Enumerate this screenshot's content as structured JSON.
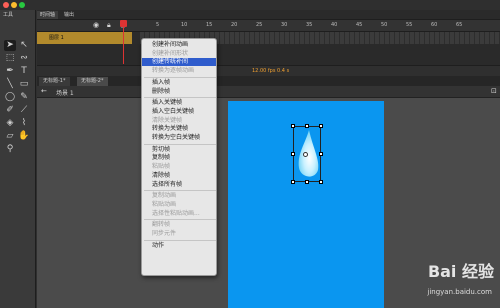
{
  "toolbox": {
    "title": "工具",
    "tools": [
      {
        "name": "selection-tool-icon",
        "glyph": "➤",
        "selected": true
      },
      {
        "name": "subselection-tool-icon",
        "glyph": "↖"
      },
      {
        "name": "free-transform-tool-icon",
        "glyph": "⬚"
      },
      {
        "name": "lasso-tool-icon",
        "glyph": "∾"
      },
      {
        "name": "pen-tool-icon",
        "glyph": "✒"
      },
      {
        "name": "text-tool-icon",
        "glyph": "T"
      },
      {
        "name": "line-tool-icon",
        "glyph": "╲"
      },
      {
        "name": "rectangle-tool-icon",
        "glyph": "▭"
      },
      {
        "name": "oval-tool-icon",
        "glyph": "◯"
      },
      {
        "name": "pencil-tool-icon",
        "glyph": "✎"
      },
      {
        "name": "brush-tool-icon",
        "glyph": "✐"
      },
      {
        "name": "bone-tool-icon",
        "glyph": "⟋"
      },
      {
        "name": "paint-bucket-icon",
        "glyph": "◈"
      },
      {
        "name": "eyedropper-icon",
        "glyph": "⌇"
      },
      {
        "name": "eraser-icon",
        "glyph": "▱"
      },
      {
        "name": "hand-tool-icon",
        "glyph": "✋"
      },
      {
        "name": "zoom-tool-icon",
        "glyph": "⚲"
      }
    ]
  },
  "panel_tabs": {
    "timeline": "时间轴",
    "output": "输出"
  },
  "timeline": {
    "layer_name": "图层 1",
    "frame_numbers": [
      "5",
      "10",
      "15",
      "20",
      "25",
      "30",
      "35",
      "40",
      "45",
      "50",
      "55",
      "60",
      "65"
    ],
    "readout": "12.00 fps  0.4 s"
  },
  "doc_tabs": [
    "无标题-1*",
    "无标题-2*"
  ],
  "scene": "场景 1",
  "context_menu": {
    "items": [
      {
        "label": "创建补间动画",
        "disabled": false
      },
      {
        "label": "创建补间形状",
        "disabled": true
      },
      {
        "label": "创建传统补间",
        "disabled": false,
        "highlighted": true
      },
      {
        "label": "转换为逐帧动画",
        "disabled": true
      },
      {
        "sep": true
      },
      {
        "label": "插入帧",
        "disabled": false
      },
      {
        "label": "删除帧",
        "disabled": false
      },
      {
        "sep": true
      },
      {
        "label": "插入关键帧",
        "disabled": false
      },
      {
        "label": "插入空白关键帧",
        "disabled": false
      },
      {
        "label": "清除关键帧",
        "disabled": true
      },
      {
        "label": "转换为关键帧",
        "disabled": false
      },
      {
        "label": "转换为空白关键帧",
        "disabled": false
      },
      {
        "sep": true
      },
      {
        "label": "剪切帧",
        "disabled": false
      },
      {
        "label": "复制帧",
        "disabled": false
      },
      {
        "label": "粘贴帧",
        "disabled": true
      },
      {
        "label": "清除帧",
        "disabled": false
      },
      {
        "label": "选择所有帧",
        "disabled": false
      },
      {
        "sep": true
      },
      {
        "label": "复制动画",
        "disabled": true
      },
      {
        "label": "粘贴动画",
        "disabled": true
      },
      {
        "label": "选择性粘贴动画...",
        "disabled": true
      },
      {
        "sep": true
      },
      {
        "label": "翻转帧",
        "disabled": true
      },
      {
        "label": "同步元件",
        "disabled": true
      },
      {
        "sep": true
      },
      {
        "label": "动作",
        "disabled": false
      }
    ]
  },
  "watermark": {
    "brand": "Bai 经验",
    "url": "jingyan.baidu.com"
  },
  "colors": {
    "stage": "#0a96f0",
    "highlight": "#2f5ccc",
    "layer": "#b28a2c"
  }
}
